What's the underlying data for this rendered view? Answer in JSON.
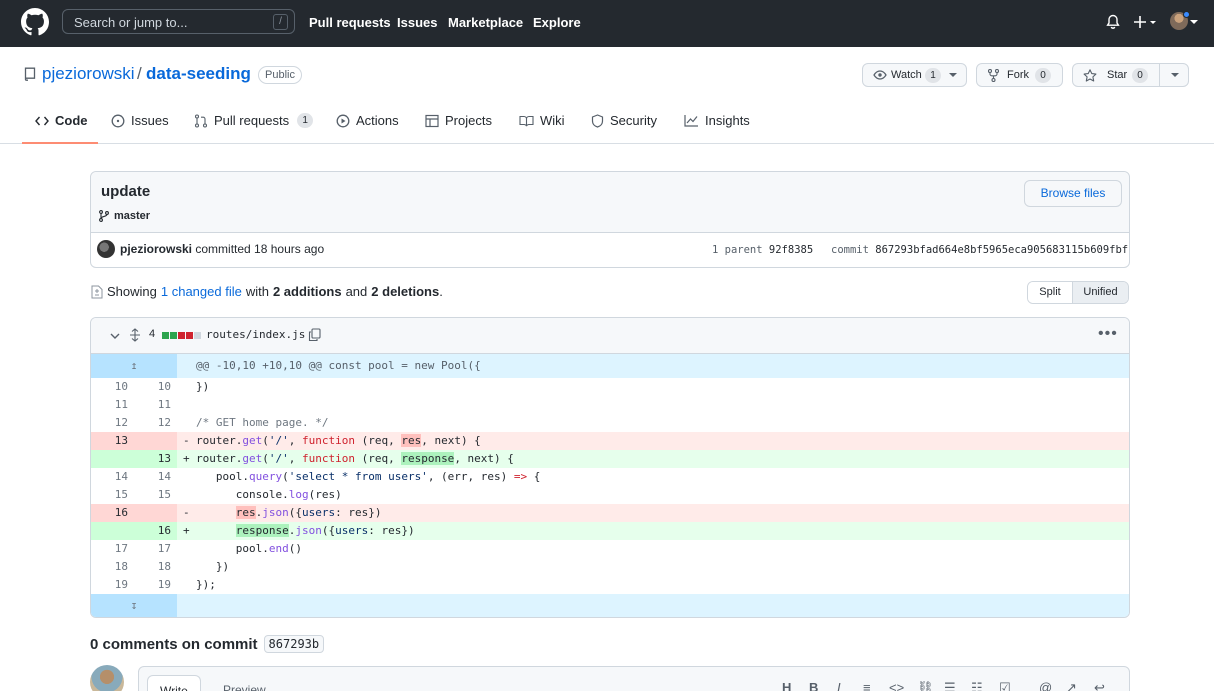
{
  "header": {
    "search_placeholder": "Search or jump to...",
    "search_shortcut": "/",
    "nav": [
      "Pull requests",
      "Issues",
      "Marketplace",
      "Explore"
    ]
  },
  "repo": {
    "owner": "pjeziorowski",
    "separator": "/",
    "name": "data-seeding",
    "visibility": "Public",
    "watch": {
      "label": "Watch",
      "count": "1"
    },
    "fork": {
      "label": "Fork",
      "count": "0"
    },
    "star": {
      "label": "Star",
      "count": "0"
    }
  },
  "tabs": [
    {
      "label": "Code",
      "active": true
    },
    {
      "label": "Issues"
    },
    {
      "label": "Pull requests",
      "count": "1"
    },
    {
      "label": "Actions"
    },
    {
      "label": "Projects"
    },
    {
      "label": "Wiki"
    },
    {
      "label": "Security"
    },
    {
      "label": "Insights"
    }
  ],
  "commit": {
    "title": "update",
    "branch": "master",
    "browse_label": "Browse files",
    "author": "pjeziorowski",
    "committed_text": "committed 18 hours ago",
    "parent_label": "1 parent",
    "parent_sha": "92f8385",
    "commit_label": "commit",
    "commit_sha": "867293bfad664e8bf5965eca905683115b609fbf"
  },
  "summary": {
    "showing": "Showing",
    "changed": "1 changed file",
    "with": "with",
    "additions": "2 additions",
    "and": "and",
    "deletions": "2 deletions",
    "period": ".",
    "split": "Split",
    "unified": "Unified"
  },
  "diff": {
    "change_count": "4",
    "file": "routes/index.js",
    "hunk": "@@ -10,10 +10,10 @@ const pool = new Pool({",
    "stat": [
      "add",
      "add",
      "del",
      "del",
      "neutral"
    ]
  },
  "colors": {
    "header_bg": "#24292f",
    "link": "#0969da",
    "del_bg": "#ffebe9",
    "add_bg": "#e6ffec",
    "hunk_bg": "#ddf4ff",
    "tab_underline": "#fd8c73"
  },
  "comments": {
    "title": "0 comments on commit",
    "sha": "867293b",
    "write_tab": "Write",
    "preview_tab": "Preview"
  }
}
